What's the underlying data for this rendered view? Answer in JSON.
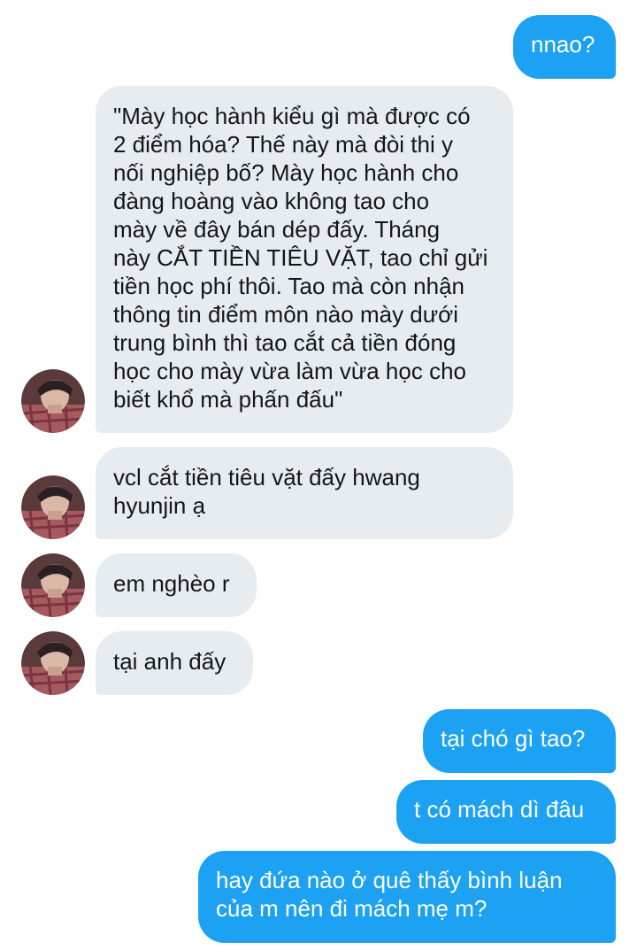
{
  "conversation": {
    "messages": [
      {
        "id": "m1",
        "direction": "sent",
        "text": "nnao?"
      },
      {
        "id": "m2",
        "direction": "received",
        "text": "\"Mày học hành kiểu gì mà được có\n2 điểm hóa? Thế này mà đòi thi y\nnối nghiệp bố? Mày học hành cho\nđàng hoàng vào không tao cho\nmày về đây bán dép đấy. Tháng\nnày CẮT TIỀN TIÊU VẶT, tao chỉ gửi\ntiền học phí thôi. Tao mà còn nhận\nthông tin điểm môn nào mày dưới\ntrung bình thì tao cắt cả tiền đóng\nhọc cho mày vừa làm vừa học cho\nbiết khổ mà phấn đấu\""
      },
      {
        "id": "m3",
        "direction": "received",
        "text": "vcl cắt tiền tiêu vặt đấy hwang\nhyunjin ạ"
      },
      {
        "id": "m4",
        "direction": "received",
        "text": "em nghèo r"
      },
      {
        "id": "m5",
        "direction": "received",
        "text": "tại anh đấy"
      },
      {
        "id": "m6",
        "direction": "sent",
        "text": "tại chó gì tao?"
      },
      {
        "id": "m7",
        "direction": "sent",
        "text": "t có mách dì đâu"
      },
      {
        "id": "m8",
        "direction": "sent",
        "text": "hay đứa nào ở quê thấy bình luận\ncủa m nên đi mách mẹ m?"
      }
    ],
    "avatar_icon": "user-avatar-photo",
    "colors": {
      "sent_bubble": "#1da1f2",
      "received_bubble": "#e6ecf0",
      "sent_text": "#ffffff",
      "received_text": "#14171a"
    }
  }
}
